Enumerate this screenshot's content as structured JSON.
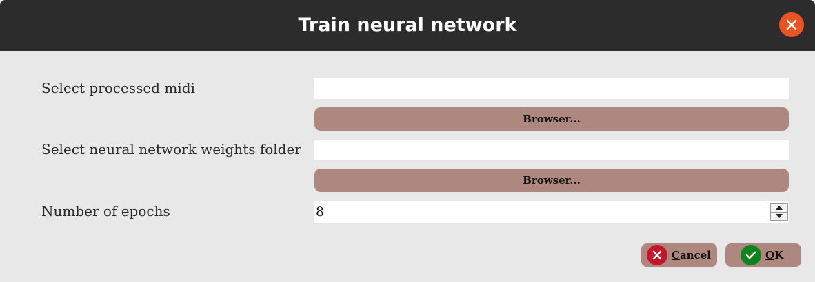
{
  "window": {
    "title": "Train neural network",
    "close_icon": "close-icon"
  },
  "form": {
    "midi": {
      "label": "Select processed midi",
      "value": "",
      "browse_label": "Browser..."
    },
    "weights": {
      "label": "Select neural network weights folder",
      "value": "",
      "browse_label": "Browser..."
    },
    "epochs": {
      "label": "Number of epochs",
      "value": "8"
    }
  },
  "actions": {
    "cancel": {
      "mnemonic": "C",
      "rest": "ancel",
      "icon": "cancel-x-icon"
    },
    "ok": {
      "mnemonic": "O",
      "rest": "K",
      "icon": "ok-check-icon"
    }
  },
  "colors": {
    "titlebar": "#2c2c2c",
    "close": "#e95420",
    "button": "#ae877e",
    "cancel_icon": "#c7162b",
    "ok_icon": "#0e8420",
    "background": "#e8e8e8"
  }
}
